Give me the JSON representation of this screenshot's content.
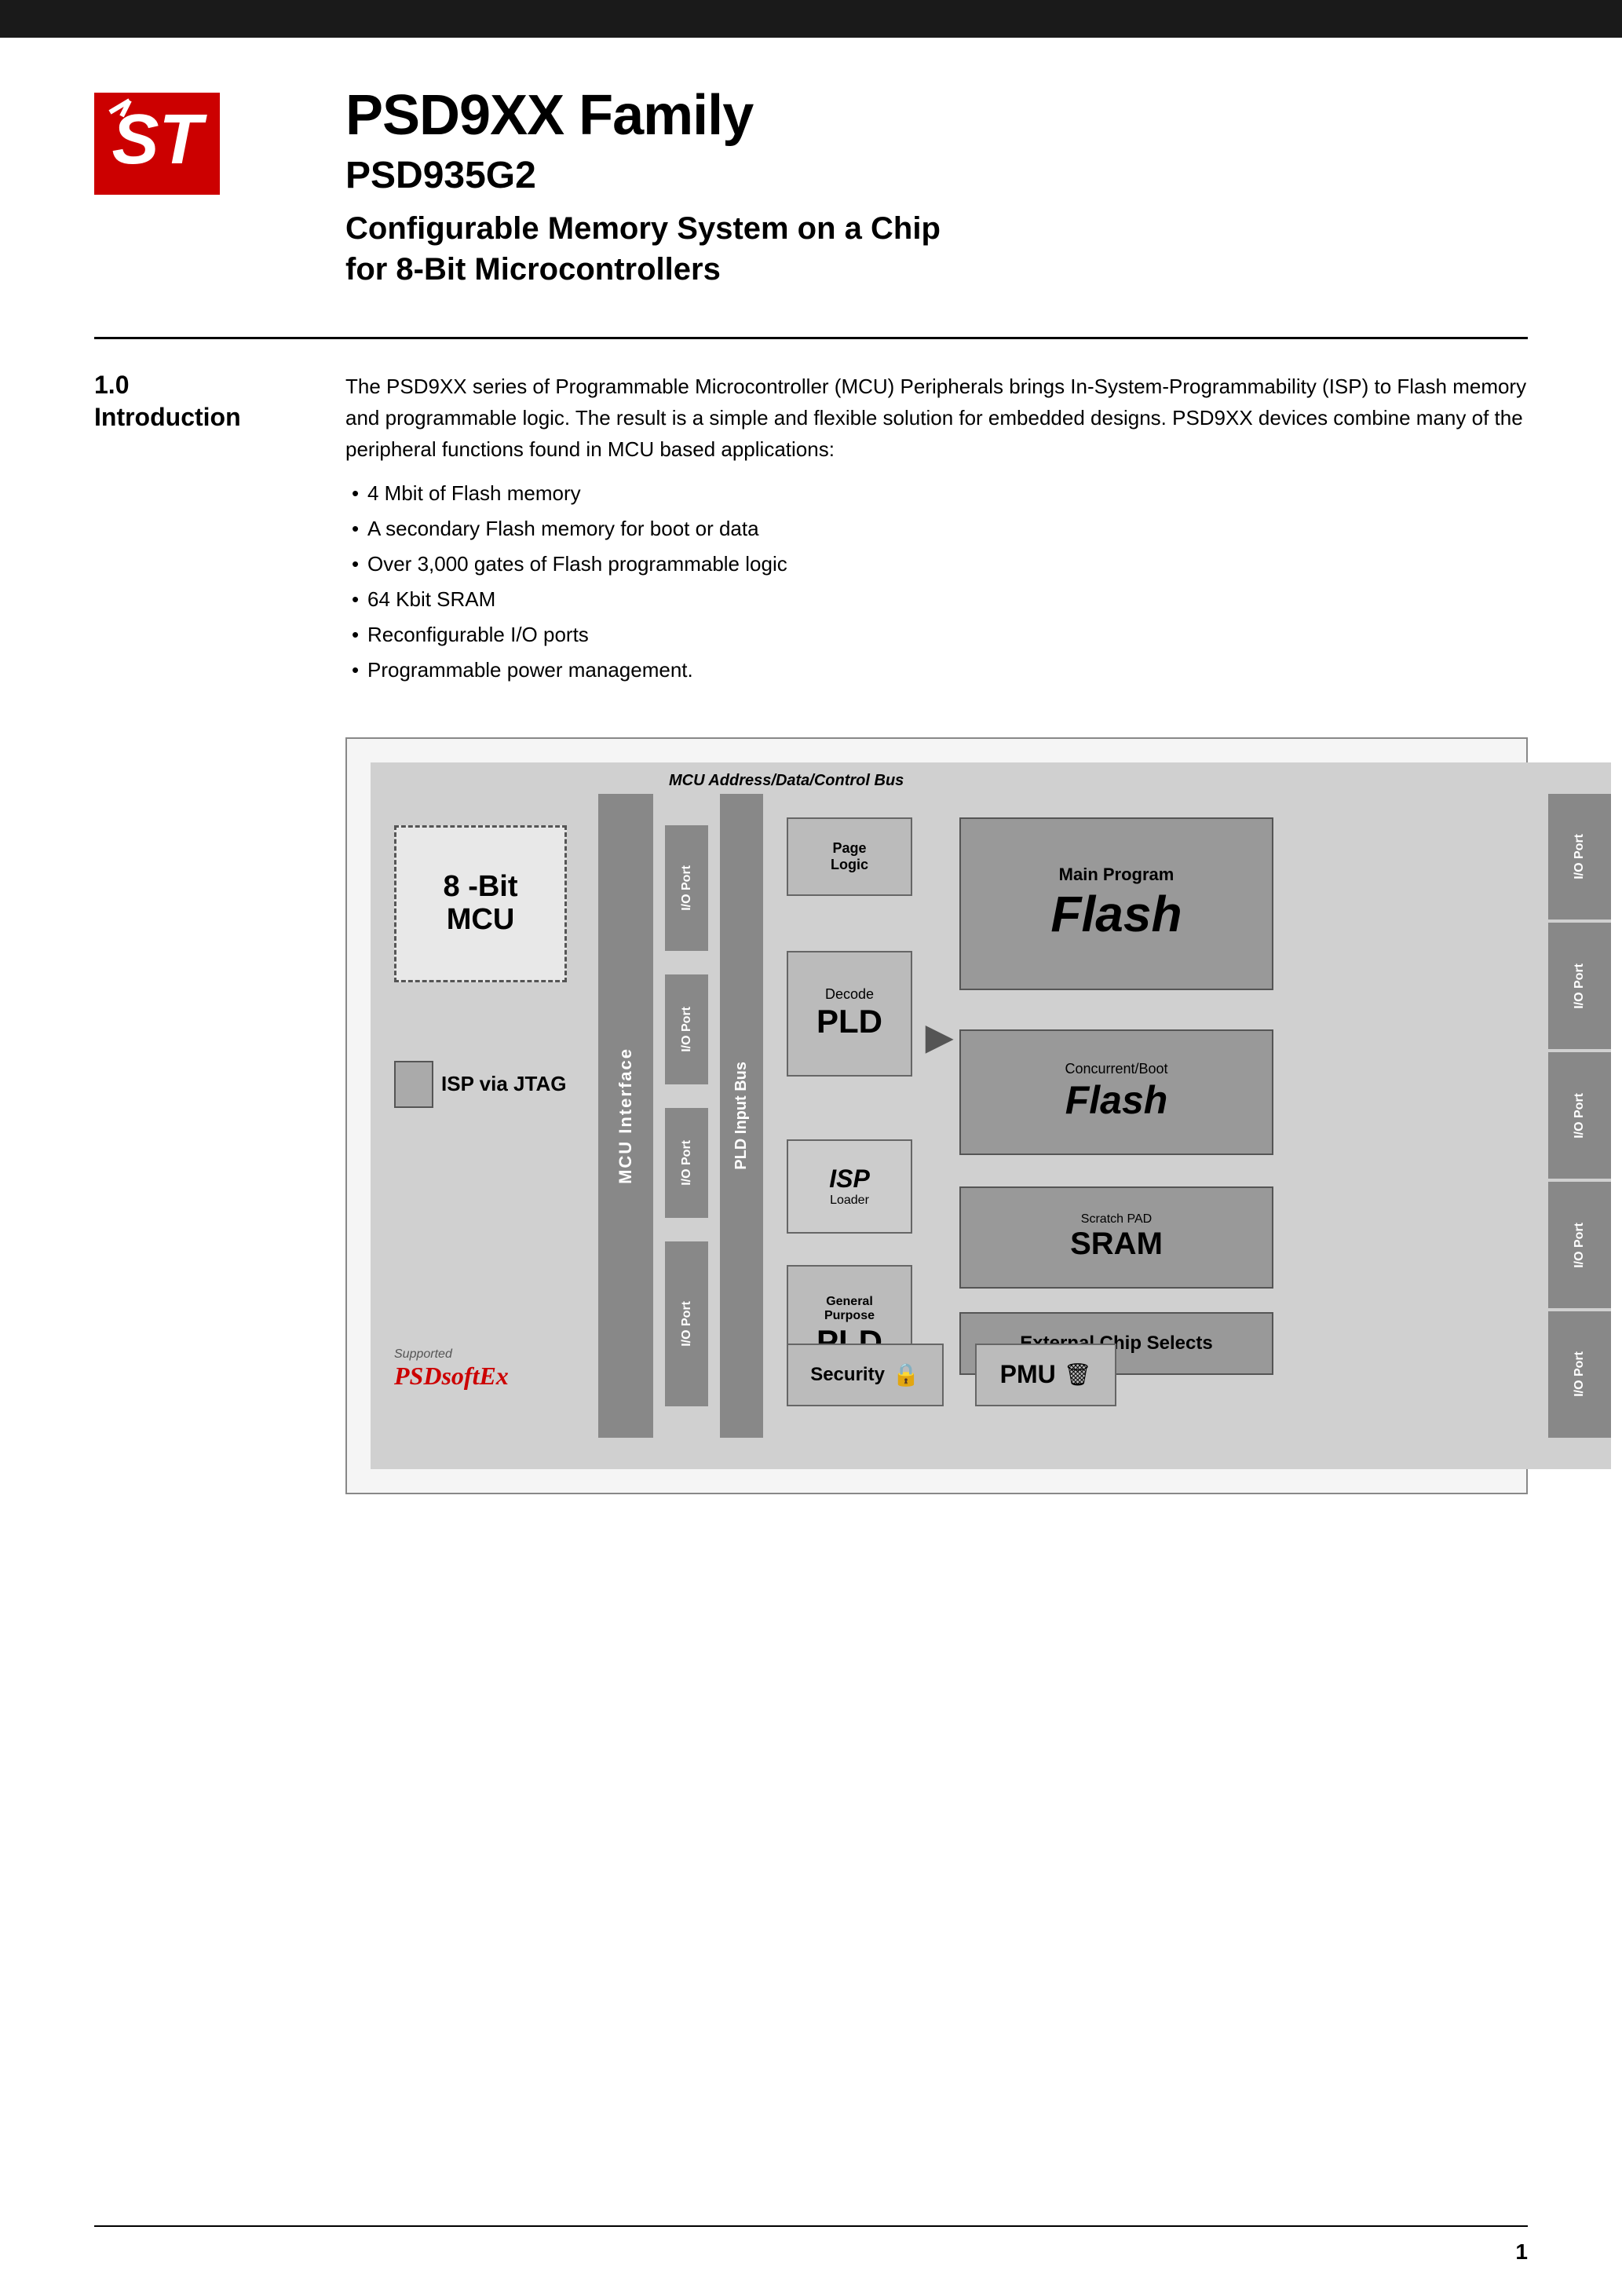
{
  "header": {
    "top_bar_color": "#1a1a1a",
    "product_family": "PSD9XX Family",
    "product_number": "PSD935G2",
    "product_description_line1": "Configurable Memory System on a Chip",
    "product_description_line2": "for 8-Bit Microcontrollers"
  },
  "section": {
    "number": "1.0",
    "title": "Introduction",
    "body": "The PSD9XX series of Programmable Microcontroller (MCU) Peripherals brings In-System-Programmability (ISP) to Flash memory and programmable logic. The result is a simple and flexible solution for embedded designs. PSD9XX devices combine many of the peripheral functions found in MCU based applications:",
    "bullets": [
      "4 Mbit of Flash memory",
      "A secondary Flash memory for boot or data",
      "Over 3,000 gates of Flash programmable logic",
      "64 Kbit SRAM",
      "Reconfigurable I/O ports",
      "Programmable power management."
    ]
  },
  "diagram": {
    "bus_label": "MCU Address/Data/Control Bus",
    "mcu_label_line1": "8 -Bit",
    "mcu_label_line2": "MCU",
    "isp_jtag_label": "ISP via JTAG",
    "mcu_interface_label": "MCU Interface",
    "io_port_label": "I/O Port",
    "pld_input_bus_label": "PLD Input Bus",
    "page_logic_label": "Page\nLogic",
    "decode_label": "Decode",
    "pld_label": "PLD",
    "isp_italic_label": "ISP",
    "loader_label": "Loader",
    "gp_label": "General\nPurpose",
    "gp_pld_label": "PLD",
    "main_program_label": "Main Program",
    "main_flash_label": "Flash",
    "concurrent_label": "Concurrent/Boot",
    "boot_flash_label": "Flash",
    "scratch_label": "Scratch PAD",
    "sram_label": "SRAM",
    "ext_chip_label": "External Chip Selects",
    "security_label": "Security",
    "pmu_label": "PMU",
    "supported_label": "Supported"
  },
  "footer": {
    "page_number": "1"
  }
}
